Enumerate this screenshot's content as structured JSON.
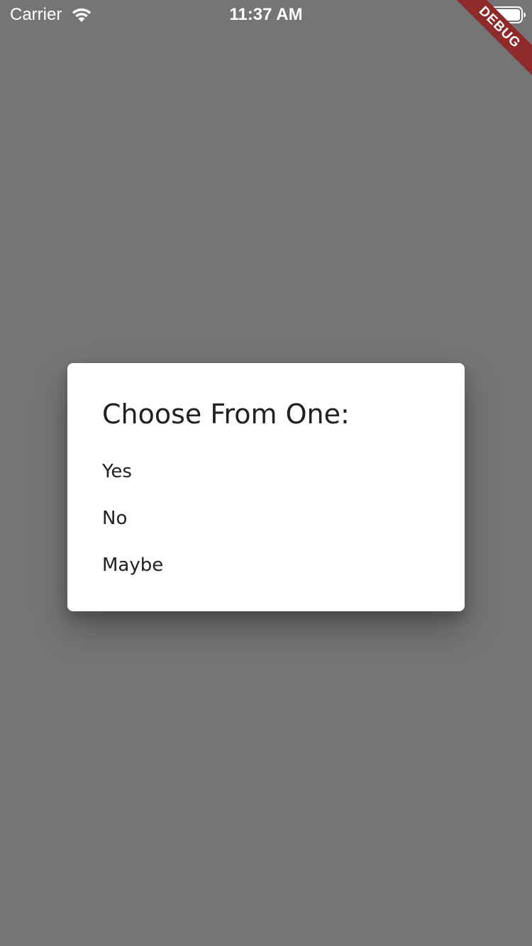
{
  "status_bar": {
    "carrier": "Carrier",
    "time": "11:37 AM",
    "wifi_icon": "wifi-icon",
    "battery_icon": "battery-icon"
  },
  "debug_banner": {
    "label": "DEBUG",
    "color": "#8e2a2a"
  },
  "dialog": {
    "title": "Choose From One:",
    "options": [
      {
        "label": "Yes"
      },
      {
        "label": "No"
      },
      {
        "label": "Maybe"
      }
    ]
  },
  "colors": {
    "scrim": "#757575",
    "dialog_background": "#ffffff",
    "text": "#212121"
  }
}
